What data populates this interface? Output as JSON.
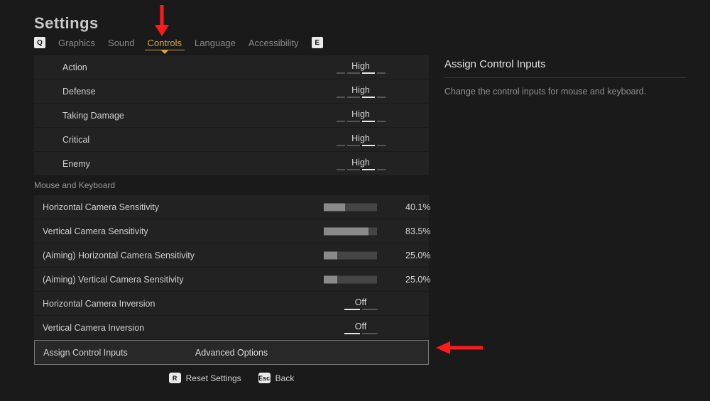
{
  "title": "Settings",
  "tabs": {
    "prev_key": "Q",
    "next_key": "E",
    "items": [
      {
        "label": "Graphics"
      },
      {
        "label": "Sound"
      },
      {
        "label": "Controls",
        "active": true
      },
      {
        "label": "Language"
      },
      {
        "label": "Accessibility"
      }
    ]
  },
  "rows_enum": [
    {
      "label": "Action",
      "value": "High"
    },
    {
      "label": "Defense",
      "value": "High"
    },
    {
      "label": "Taking Damage",
      "value": "High"
    },
    {
      "label": "Critical",
      "value": "High"
    },
    {
      "label": "Enemy",
      "value": "High"
    }
  ],
  "section_mouse_keyboard": "Mouse and Keyboard",
  "sliders": [
    {
      "label": "Horizontal Camera Sensitivity",
      "value": 40.1,
      "display": "40.1%"
    },
    {
      "label": "Vertical Camera Sensitivity",
      "value": 83.5,
      "display": "83.5%"
    },
    {
      "label": "(Aiming) Horizontal Camera Sensitivity",
      "value": 25.0,
      "display": "25.0%"
    },
    {
      "label": "(Aiming) Vertical Camera Sensitivity",
      "value": 25.0,
      "display": "25.0%"
    }
  ],
  "toggles": [
    {
      "label": "Horizontal Camera Inversion",
      "value": "Off"
    },
    {
      "label": "Vertical Camera Inversion",
      "value": "Off"
    }
  ],
  "assign_row": {
    "label": "Assign Control Inputs",
    "value": "Advanced Options"
  },
  "detail": {
    "heading": "Assign Control Inputs",
    "text": "Change the control inputs for mouse and keyboard."
  },
  "footer": {
    "reset_key": "R",
    "reset_label": "Reset Settings",
    "back_key": "Esc",
    "back_label": "Back"
  }
}
